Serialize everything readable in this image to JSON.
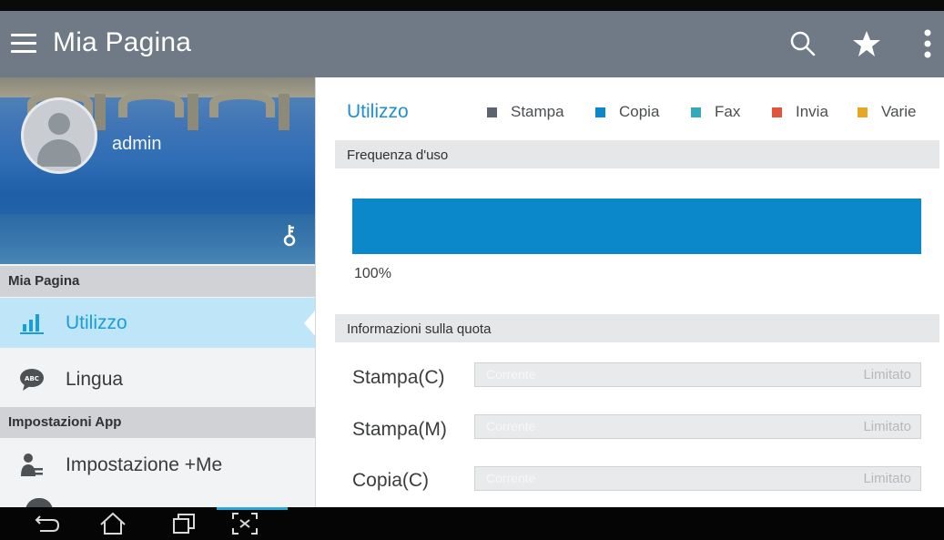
{
  "appbar": {
    "title": "Mia Pagina",
    "icons": [
      "menu-icon",
      "search-icon",
      "star-icon",
      "overflow-icon"
    ]
  },
  "sidebar": {
    "username": "admin",
    "section_mypage": "Mia Pagina",
    "section_app": "Impostazioni App",
    "items": [
      {
        "label": "Utilizzo",
        "icon": "bar-chart-icon",
        "active": true
      },
      {
        "label": "Lingua",
        "icon": "language-bubble-icon",
        "active": false
      },
      {
        "label": "Impostazione +Me",
        "icon": "user-settings-icon",
        "active": false
      }
    ]
  },
  "main": {
    "title": "Utilizzo",
    "legend": [
      {
        "label": "Stampa",
        "color": "#5b6470"
      },
      {
        "label": "Copia",
        "color": "#0a88c9"
      },
      {
        "label": "Fax",
        "color": "#33a9bd"
      },
      {
        "label": "Invia",
        "color": "#e2553a"
      },
      {
        "label": "Varie",
        "color": "#e8a722"
      }
    ],
    "frequency_label": "Frequenza d'uso",
    "usage_percent_label": "100%",
    "usage_fraction": 1.0,
    "quota_label": "Informazioni sulla quota",
    "quotas": [
      {
        "label": "Stampa(C)",
        "current": "Corrente",
        "limit": "Limitato"
      },
      {
        "label": "Stampa(M)",
        "current": "Corrente",
        "limit": "Limitato"
      },
      {
        "label": "Copia(C)",
        "current": "Corrente",
        "limit": "Limitato"
      }
    ]
  },
  "navbar": {
    "icons": [
      "back-icon",
      "home-icon",
      "recent-apps-icon",
      "screenshot-icon"
    ]
  },
  "colors": {
    "appbar": "#6f7a86",
    "accent": "#1f8fcf",
    "active_bg": "#bfe6f8",
    "usage_bar": "#0a88c9"
  }
}
